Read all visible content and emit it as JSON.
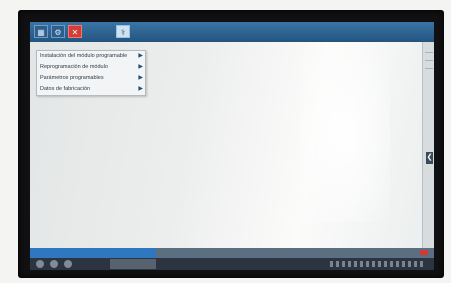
{
  "toolbar": {
    "buttons": [
      {
        "name": "home",
        "icon": "grid-icon"
      },
      {
        "name": "tools",
        "icon": "wrench-icon"
      },
      {
        "name": "close",
        "icon": "close-icon"
      },
      {
        "name": "diagnostic",
        "icon": "stethoscope-icon"
      }
    ],
    "accent_color": "#23547f"
  },
  "menu": {
    "items": [
      {
        "label": "Instalación del módulo programable",
        "arrow": "▶"
      },
      {
        "label": "Reprogramación de módulo",
        "arrow": "▶"
      },
      {
        "label": "Parámetros programables",
        "arrow": "▶"
      },
      {
        "label": "Datos de fabricación",
        "arrow": "▶"
      }
    ]
  },
  "side_tab": {
    "glyph": "❮"
  },
  "status": {
    "progress_color": "#2f78bf",
    "alert_color": "#d13a33"
  }
}
